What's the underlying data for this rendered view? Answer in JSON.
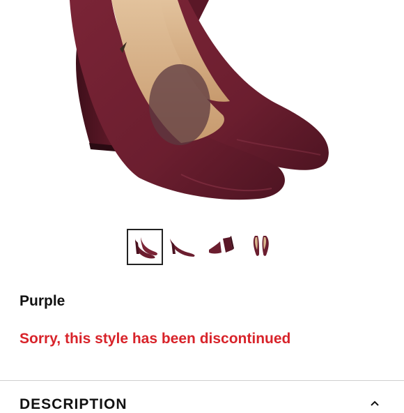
{
  "product": {
    "image_alt": "Purple leather pointed-toe block heel pumps",
    "color_label": "Purple",
    "status_message": "Sorry, this style has been discontinued"
  },
  "gallery": {
    "thumbnails": [
      {
        "view": "pair-side",
        "selected": true
      },
      {
        "view": "single-side",
        "selected": false
      },
      {
        "view": "pair-back",
        "selected": false
      },
      {
        "view": "top",
        "selected": false
      }
    ]
  },
  "description": {
    "title": "DESCRIPTION",
    "toggle_icon": "chevron-up-icon"
  },
  "colors": {
    "leather": "#6e1f30",
    "leather_dark": "#4a1220",
    "lining": "#d8b48c",
    "error": "#d8232a"
  }
}
